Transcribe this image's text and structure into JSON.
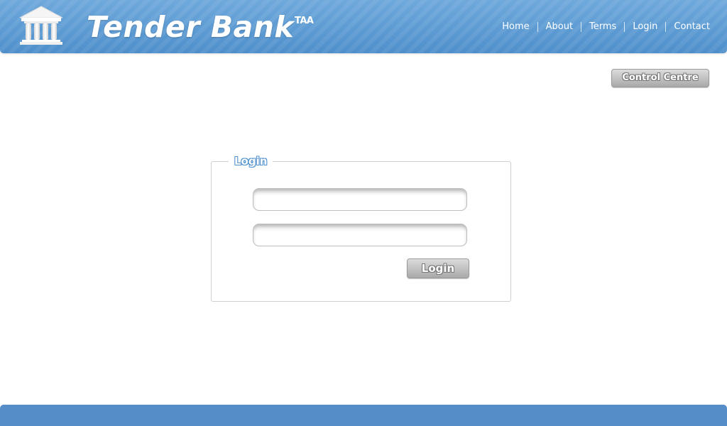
{
  "header": {
    "logo_icon": "bank-building-icon",
    "brand": "Tender Bank",
    "brand_suffix": "TAA",
    "nav": [
      {
        "label": "Home"
      },
      {
        "label": "About"
      },
      {
        "label": "Terms"
      },
      {
        "label": "Login"
      },
      {
        "label": "Contact"
      }
    ]
  },
  "control_centre": {
    "label": "Control Centre"
  },
  "login": {
    "legend": "Login",
    "username_value": "",
    "password_value": "",
    "submit_label": "Login"
  },
  "colors": {
    "header_blue": "#5b9bd5",
    "footer_blue": "#558dc9",
    "button_gray": "#b5b5b5",
    "legend_blue": "#4e8fcb"
  }
}
